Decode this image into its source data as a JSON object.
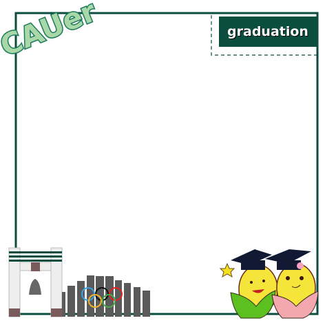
{
  "logo": {
    "text": "CAUer"
  },
  "header": {
    "label": "graduation"
  },
  "colors": {
    "frame": "#0b4d3f",
    "logo_fill": "#a8d8a8",
    "logo_stroke": "#1c7a5a"
  }
}
